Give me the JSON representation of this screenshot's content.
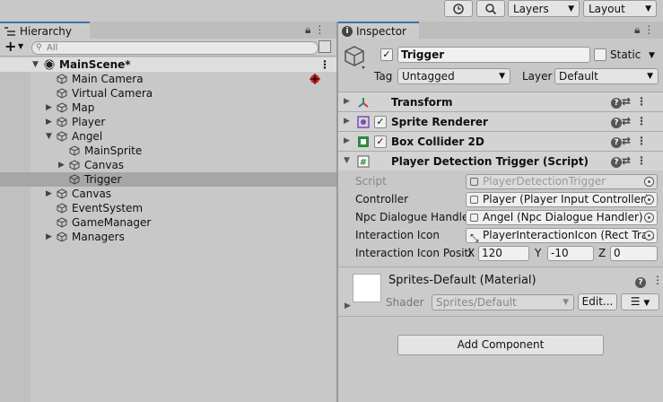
{
  "toolbar": {
    "layers_label": "Layers",
    "layout_label": "Layout"
  },
  "hierarchy": {
    "tab_label": "Hierarchy",
    "add_label": "+",
    "search_placeholder": "All",
    "scene_name": "MainScene*",
    "items": [
      {
        "label": "Main Camera"
      },
      {
        "label": "Virtual Camera"
      },
      {
        "label": "Map"
      },
      {
        "label": "Player"
      },
      {
        "label": "Angel"
      },
      {
        "label": "MainSprite"
      },
      {
        "label": "Canvas"
      },
      {
        "label": "Trigger"
      },
      {
        "label": "Canvas"
      },
      {
        "label": "EventSystem"
      },
      {
        "label": "GameManager"
      },
      {
        "label": "Managers"
      }
    ]
  },
  "inspector": {
    "tab_label": "Inspector",
    "object_name": "Trigger",
    "static_label": "Static",
    "tag_label": "Tag",
    "tag_value": "Untagged",
    "layer_label": "Layer",
    "layer_value": "Default",
    "components": [
      {
        "name": "Transform"
      },
      {
        "name": "Sprite Renderer"
      },
      {
        "name": "Box Collider 2D"
      },
      {
        "name": "Player Detection Trigger (Script)"
      }
    ],
    "script_fields": {
      "script_label": "Script",
      "script_value": "PlayerDetectionTrigger",
      "controller_label": "Controller",
      "controller_value": "Player (Player Input Controller)",
      "npc_label": "Npc Dialogue Handler",
      "npc_value": "Angel (Npc Dialogue Handler)",
      "icon_label": "Interaction Icon",
      "icon_value": "PlayerInteractionIcon (Rect Tran",
      "pos_label": "Interaction Icon Positi",
      "x_label": "X",
      "x_value": "120",
      "y_label": "Y",
      "y_value": "-10",
      "z_label": "Z",
      "z_value": "0"
    },
    "material": {
      "name": "Sprites-Default (Material)",
      "shader_label": "Shader",
      "shader_value": "Sprites/Default",
      "edit_label": "Edit..."
    },
    "add_component_label": "Add Component"
  }
}
